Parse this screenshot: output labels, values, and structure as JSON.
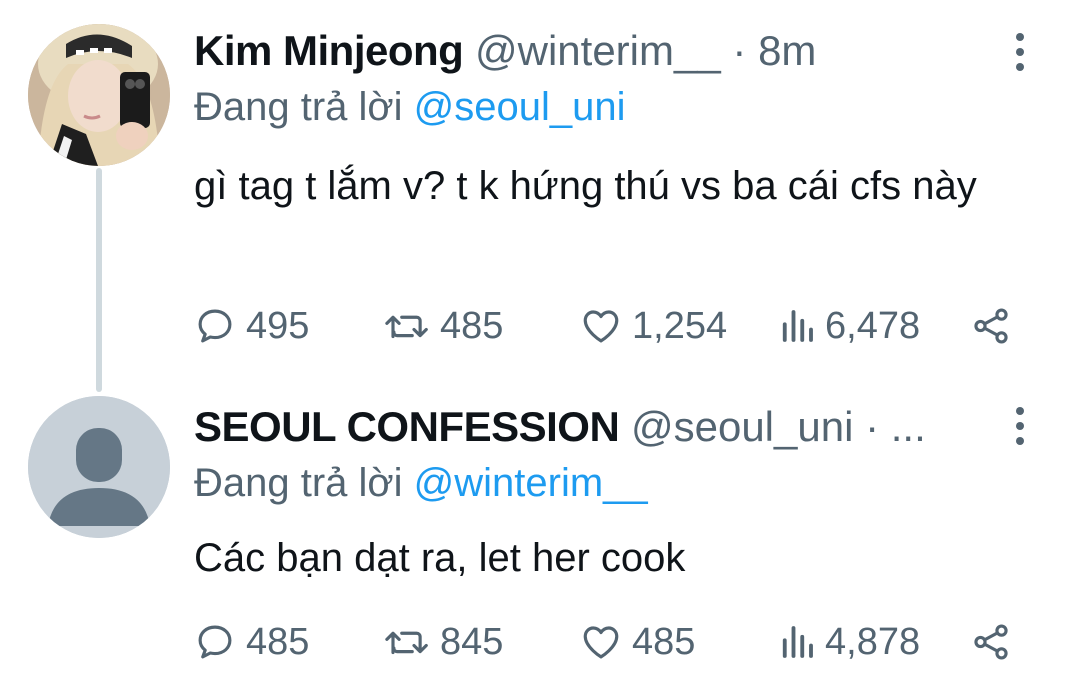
{
  "tweets": [
    {
      "name": "Kim Minjeong",
      "handle": "@winterim__",
      "separator": "·",
      "time": "8m",
      "replying_prefix": "Đang trả lời",
      "replying_to": "@seoul_uni",
      "text": "gì tag t lắm v? t k hứng thú vs ba cái cfs này",
      "replies": "495",
      "retweets": "485",
      "likes": "1,254",
      "views": "6,478"
    },
    {
      "name": "SEOUL CONFESSION",
      "handle": "@seoul_uni",
      "separator": "·",
      "time": "...",
      "replying_prefix": "Đang trả lời",
      "replying_to": "@winterim__",
      "text": "Các bạn dạt ra, let her cook",
      "replies": "485",
      "retweets": "845",
      "likes": "485",
      "views": "4,878"
    }
  ],
  "icons": {
    "reply": "reply-icon",
    "retweet": "retweet-icon",
    "like": "heart-icon",
    "views": "views-icon",
    "share": "share-icon",
    "more": "more-options-icon"
  },
  "colors": {
    "text": "#0f1419",
    "secondary": "#536471",
    "accent": "#1d9bf0",
    "thread_line": "#cfd9de",
    "default_avatar_bg": "#c7d0d8",
    "default_avatar_fg": "#657786"
  }
}
